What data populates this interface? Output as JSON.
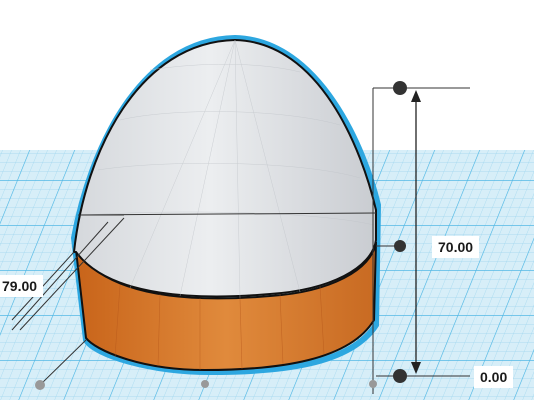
{
  "viewport": {
    "dimensions": {
      "height": "70.00",
      "elevation": "0.00",
      "depth": "79.00"
    },
    "colors": {
      "workplane": "#cfe9f5",
      "grid_line": "#8fd0ec",
      "shape_dome": "#e3e5e8",
      "shape_base": "#d97b2c",
      "selection_outline": "#2da7e0",
      "dimension_line": "#222222"
    },
    "icons": {
      "handle": "dimension-handle-icon",
      "arrow": "dimension-arrow-icon"
    }
  }
}
